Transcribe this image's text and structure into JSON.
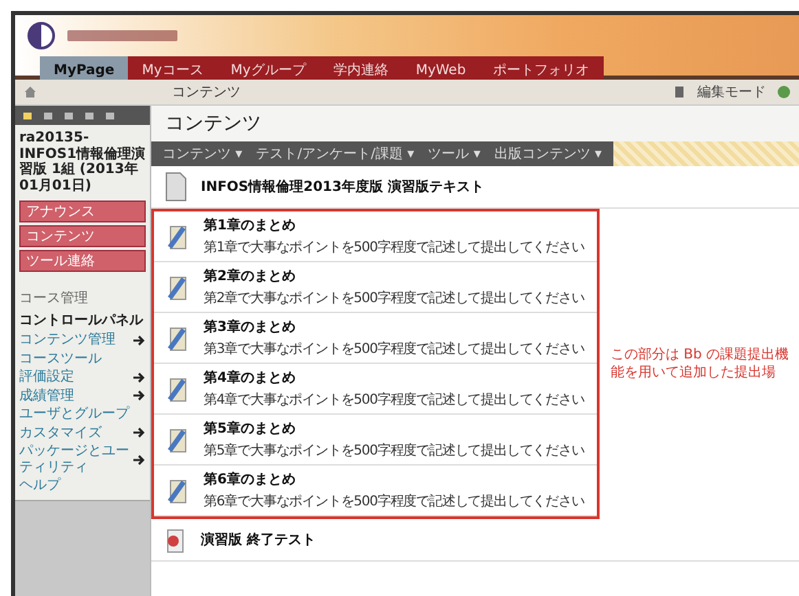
{
  "tabs": [
    {
      "label": "MyPage",
      "selected": true
    },
    {
      "label": "Myコース",
      "selected": false
    },
    {
      "label": "Myグループ",
      "selected": false
    },
    {
      "label": "学内連絡",
      "selected": false
    },
    {
      "label": "MyWeb",
      "selected": false
    },
    {
      "label": "ポートフォリオ",
      "selected": false
    }
  ],
  "breadcrumb": "コンテンツ",
  "mode": "編集モード",
  "sidebar": {
    "course_title": "ra20135-INFOS1情報倫理演習版 1組 (2013年01月01日)",
    "menu_buttons": [
      "アナウンス",
      "コンテンツ",
      "ツール連絡"
    ],
    "section_label": "コース管理",
    "panel_title": "コントロールパネル",
    "items": [
      {
        "label": "コンテンツ管理",
        "has_submenu": true
      },
      {
        "label": "コースツール",
        "has_submenu": false
      },
      {
        "label": "評価設定",
        "has_submenu": true
      },
      {
        "label": "成績管理",
        "has_submenu": true
      },
      {
        "label": "ユーザとグループ",
        "has_submenu": false
      },
      {
        "label": "カスタマイズ",
        "has_submenu": true
      },
      {
        "label": "パッケージとユーティリティ",
        "has_submenu": true
      },
      {
        "label": "ヘルプ",
        "has_submenu": false
      }
    ]
  },
  "content": {
    "heading": "コンテンツ",
    "actions": [
      "コンテンツ ▾",
      "テスト/アンケート/課題 ▾",
      "ツール ▾",
      "出版コンテンツ ▾"
    ],
    "document": {
      "title": "INFOS情報倫理2013年度版 演習版テキスト"
    },
    "assignments": [
      {
        "title": "第1章のまとめ",
        "description": "第1章で大事なポイントを500字程度で記述して提出してください"
      },
      {
        "title": "第2章のまとめ",
        "description": "第2章で大事なポイントを500字程度で記述して提出してください"
      },
      {
        "title": "第3章のまとめ",
        "description": "第3章で大事なポイントを500字程度で記述して提出してください"
      },
      {
        "title": "第4章のまとめ",
        "description": "第4章で大事なポイントを500字程度で記述して提出してください"
      },
      {
        "title": "第5章のまとめ",
        "description": "第5章で大事なポイントを500字程度で記述して提出してください"
      },
      {
        "title": "第6章のまとめ",
        "description": "第6章で大事なポイントを500字程度で記述して提出してください"
      }
    ],
    "annotation": "この部分は Bb の課題提出機能を用いて追加した提出場",
    "test": {
      "title": "演習版 終了テスト"
    }
  }
}
